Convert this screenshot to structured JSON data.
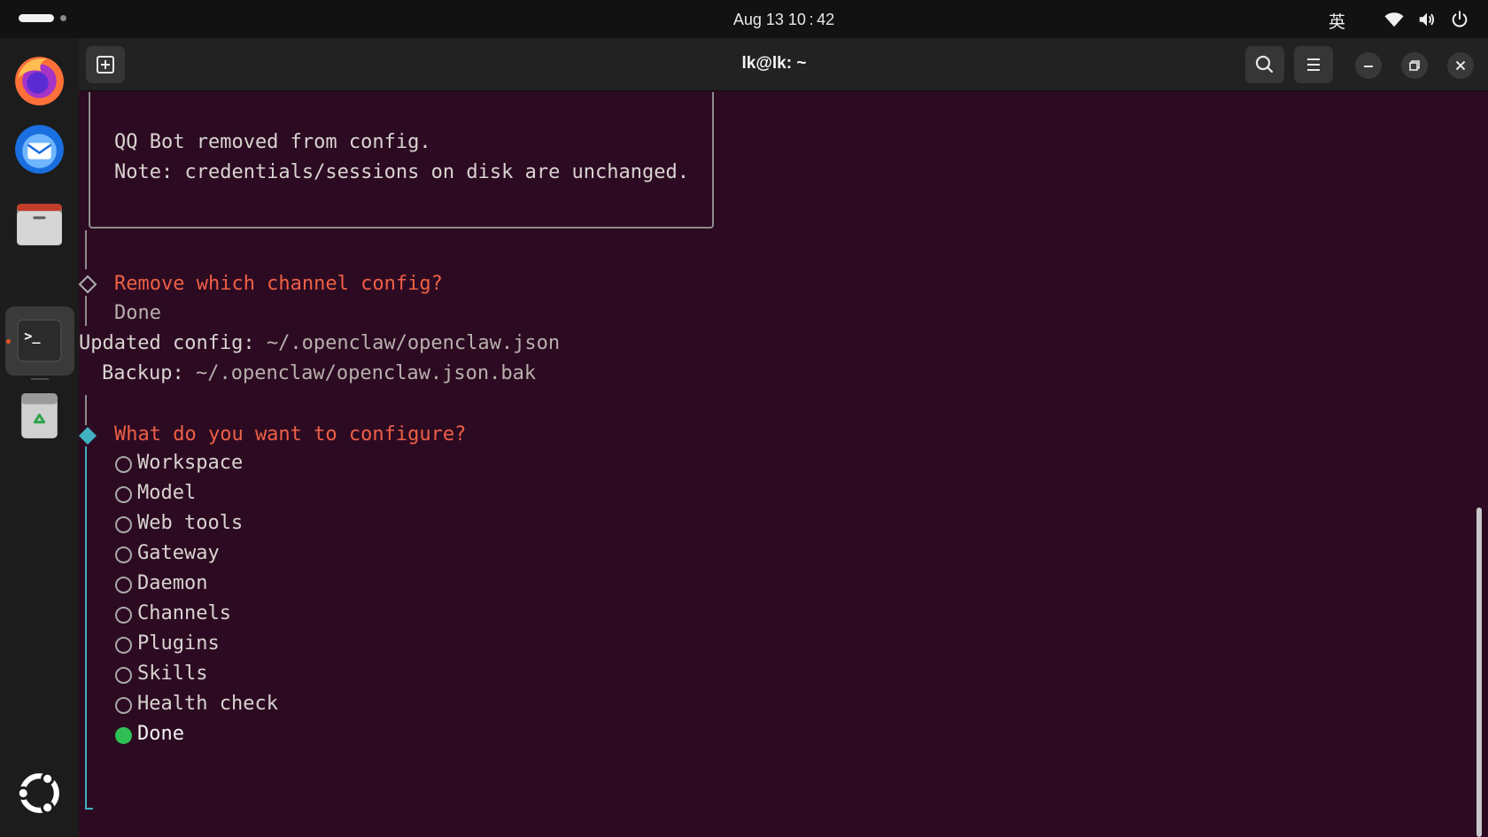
{
  "topbar": {
    "clock": "Aug 13  10 : 42",
    "input_method": "英",
    "icons": [
      "wifi-icon",
      "volume-icon",
      "power-icon"
    ]
  },
  "dock": {
    "apps": [
      "firefox-icon",
      "thunderbird-icon",
      "files-icon",
      "terminal-icon",
      "trash-icon"
    ],
    "show_apps_icon": "ubuntu-logo-icon"
  },
  "window": {
    "title": "lk@lk: ~",
    "buttons": [
      "new-tab-icon",
      "search-icon",
      "menu-icon",
      "minimize-icon",
      "restore-icon",
      "close-icon"
    ]
  },
  "terminal": {
    "note_lines": [
      "QQ Bot removed from config.",
      "Note: credentials/sessions on disk are unchanged."
    ],
    "prompt1": "Remove which channel config?",
    "prompt1_answer": "Done",
    "updated_label": "Updated config:",
    "updated_path": "~/.openclaw/openclaw.json",
    "backup_label": "Backup:",
    "backup_path": "~/.openclaw/openclaw.json.bak",
    "prompt2": "What do you want to configure?",
    "options": [
      "Workspace",
      "Model",
      "Web tools",
      "Gateway",
      "Daemon",
      "Channels",
      "Plugins",
      "Skills",
      "Health check",
      "Done"
    ],
    "selected_option": "Done"
  },
  "colors": {
    "terminal_bg": "#2c0b22",
    "prompt": "#ef5f45",
    "active_diamond": "#3fb1c1",
    "selected_radio": "#2fbf55",
    "accent": "#e95420"
  }
}
